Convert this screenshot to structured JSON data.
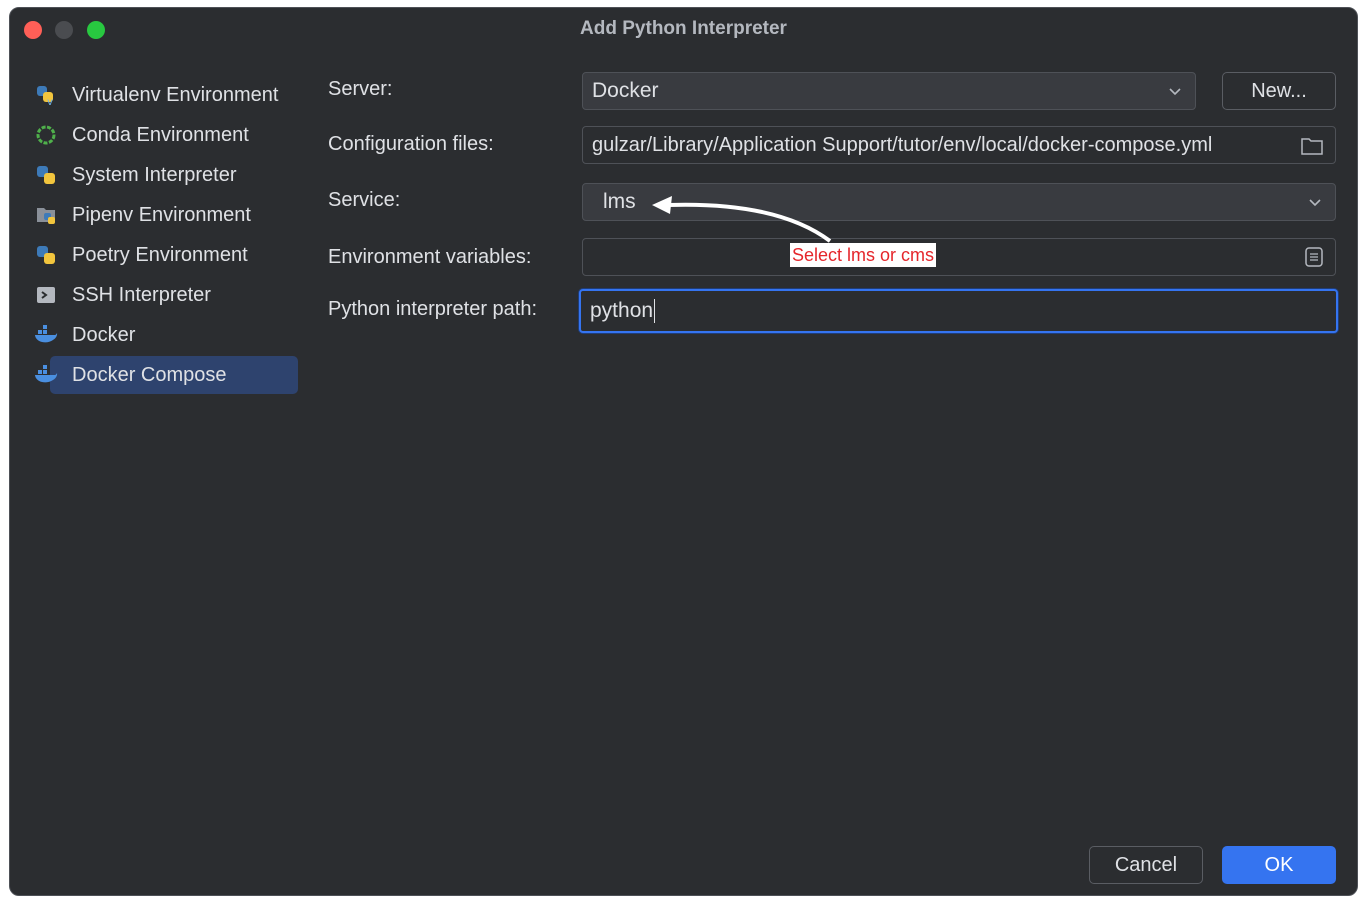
{
  "window": {
    "title": "Add Python Interpreter"
  },
  "sidebar": {
    "items": [
      {
        "label": "Virtualenv Environment",
        "icon": "python-virtualenv-icon"
      },
      {
        "label": "Conda Environment",
        "icon": "conda-icon"
      },
      {
        "label": "System Interpreter",
        "icon": "python-icon"
      },
      {
        "label": "Pipenv Environment",
        "icon": "pipenv-icon"
      },
      {
        "label": "Poetry Environment",
        "icon": "poetry-icon"
      },
      {
        "label": "SSH Interpreter",
        "icon": "ssh-terminal-icon"
      },
      {
        "label": "Docker",
        "icon": "docker-icon"
      },
      {
        "label": "Docker Compose",
        "icon": "docker-compose-icon",
        "selected": true
      }
    ]
  },
  "form": {
    "server_label": "Server:",
    "server_value": "Docker",
    "new_button": "New...",
    "config_label": "Configuration files:",
    "config_value": "gulzar/Library/Application Support/tutor/env/local/docker-compose.yml",
    "service_label": "Service:",
    "service_value": "lms",
    "env_label": "Environment variables:",
    "env_value": "",
    "interpreter_label": "Python interpreter path:",
    "interpreter_value": "python"
  },
  "annotation": {
    "text": "Select lms or cms",
    "color": "#e5262b"
  },
  "footer": {
    "cancel": "Cancel",
    "ok": "OK"
  },
  "colors": {
    "accent": "#3574f0",
    "background": "#2b2d30",
    "selection": "#2e436e"
  }
}
